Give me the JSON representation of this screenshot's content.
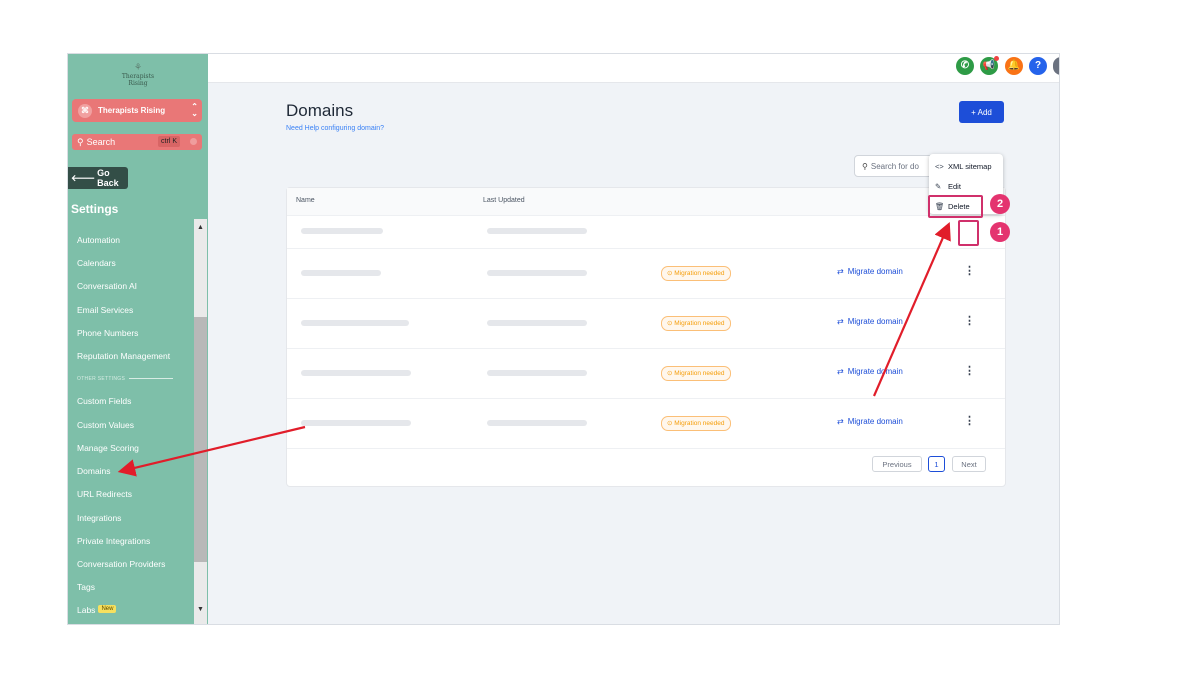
{
  "sidebar": {
    "logo_text": "Therapists Rising",
    "account_name": "Therapists Rising",
    "search_label": "Search",
    "search_shortcut": "ctrl K",
    "go_back": "Go Back",
    "settings_title": "Settings",
    "items": [
      {
        "label": "Automation"
      },
      {
        "label": "Calendars"
      },
      {
        "label": "Conversation AI"
      },
      {
        "label": "Email Services"
      },
      {
        "label": "Phone Numbers"
      },
      {
        "label": "Reputation Management"
      },
      {
        "label": "OTHER SETTINGS",
        "section": true
      },
      {
        "label": "Custom Fields"
      },
      {
        "label": "Custom Values"
      },
      {
        "label": "Manage Scoring"
      },
      {
        "label": "Domains",
        "active": true
      },
      {
        "label": "URL Redirects"
      },
      {
        "label": "Integrations"
      },
      {
        "label": "Private Integrations"
      },
      {
        "label": "Conversation Providers"
      },
      {
        "label": "Tags"
      },
      {
        "label": "Labs",
        "badge": "New"
      }
    ]
  },
  "topbar": {
    "icons": [
      "phone-icon",
      "megaphone-icon",
      "bell-icon",
      "help-icon"
    ],
    "colors": {
      "phone": "#2e9b46",
      "megaphone": "#2e9b46",
      "bell": "#f97316",
      "help": "#2563eb"
    }
  },
  "main": {
    "title": "Domains",
    "help_link": "Need Help configuring domain?",
    "add_button": "+ Add",
    "search_placeholder": "Search for do",
    "columns": [
      "Name",
      "Last Updated"
    ],
    "rows": [
      {
        "status": "",
        "action": ""
      },
      {
        "status": "Migration needed",
        "action": "Migrate domain"
      },
      {
        "status": "Migration needed",
        "action": "Migrate domain"
      },
      {
        "status": "Migration needed",
        "action": "Migrate domain"
      },
      {
        "status": "Migration needed",
        "action": "Migrate domain"
      }
    ],
    "pagination": {
      "previous": "Previous",
      "page": "1",
      "next": "Next"
    }
  },
  "dropdown": {
    "items": [
      {
        "label": "XML sitemap",
        "icon": "code-icon"
      },
      {
        "label": "Edit",
        "icon": "pencil-icon"
      },
      {
        "label": "Delete",
        "icon": "trash-icon"
      }
    ]
  },
  "annotations": {
    "step1": "1",
    "step2": "2",
    "accent": "#e4336f"
  },
  "colors": {
    "sidebar": "#7ebfa9",
    "primary": "#1d4ed8",
    "warning": "#f59e0b"
  }
}
